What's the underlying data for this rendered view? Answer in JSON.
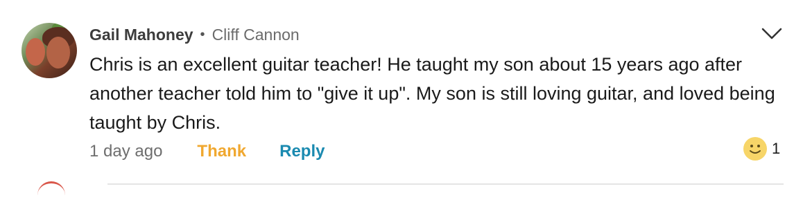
{
  "comment": {
    "author": "Gail Mahoney",
    "separator": "•",
    "target": "Cliff Cannon",
    "text": "Chris is an excellent guitar teacher! He taught my son about 15 years ago after another teacher told him to \"give it up\".  My son is still loving guitar, and loved being taught by Chris.",
    "time": "1 day ago",
    "thank_label": "Thank",
    "reply_label": "Reply",
    "reaction": {
      "icon": "smiley-face-icon",
      "count": "1"
    },
    "menu_icon": "chevron-down-icon"
  },
  "colors": {
    "thank": "#f0a830",
    "reply": "#1a8ab0",
    "emoji": "#f7d568"
  }
}
